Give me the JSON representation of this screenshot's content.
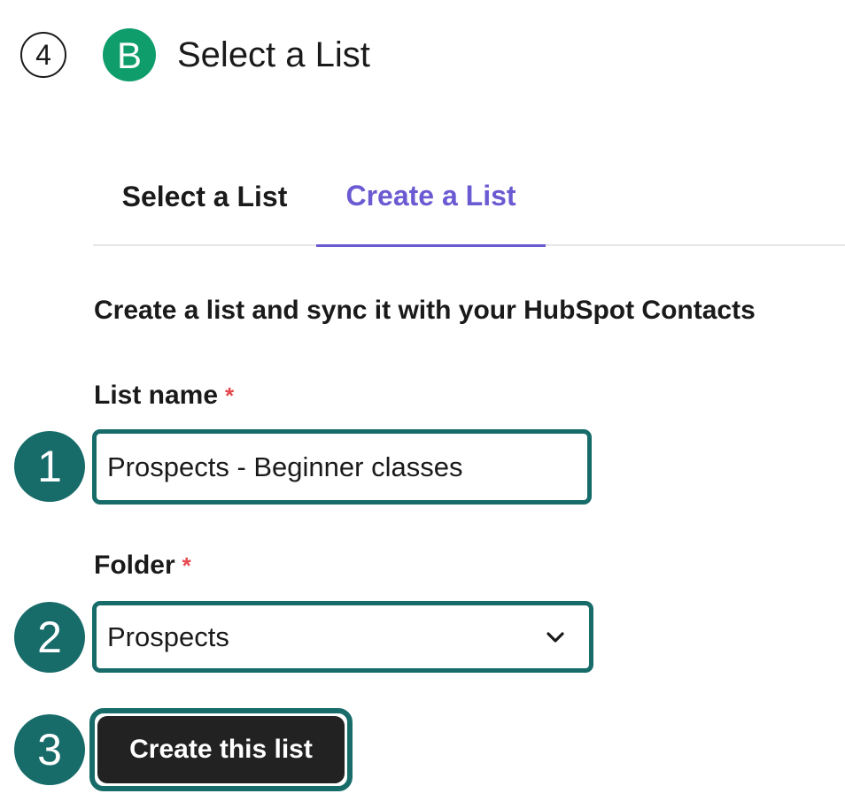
{
  "header": {
    "step_number": "4",
    "brand_logo_letter": "B",
    "title": "Select a List"
  },
  "tabs": [
    {
      "label": "Select a List",
      "active": false
    },
    {
      "label": "Create a List",
      "active": true
    }
  ],
  "form": {
    "description": "Create a list and sync it with your HubSpot Contacts",
    "list_name": {
      "label": "List name",
      "required_marker": "*",
      "value": "Prospects - Beginner classes"
    },
    "folder": {
      "label": "Folder",
      "required_marker": "*",
      "selected": "Prospects"
    },
    "submit_label": "Create this list"
  },
  "callouts": [
    "1",
    "2",
    "3"
  ],
  "colors": {
    "brand_green": "#0f9d6c",
    "active_tab": "#6b5bd2",
    "callout_teal": "#176c6a",
    "required_red": "#e5484d",
    "button_dark": "#222222"
  },
  "icons": {
    "brand": "brevo-logo-icon",
    "select_arrow": "chevron-down-icon"
  }
}
